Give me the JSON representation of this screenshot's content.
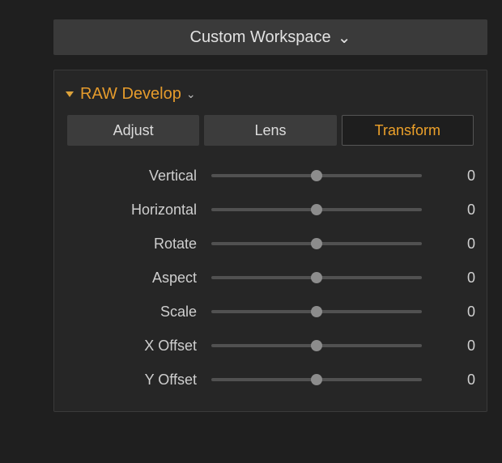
{
  "workspace": {
    "label": "Custom Workspace"
  },
  "section": {
    "title": "RAW Develop"
  },
  "tabs": [
    {
      "label": "Adjust",
      "active": false
    },
    {
      "label": "Lens",
      "active": false
    },
    {
      "label": "Transform",
      "active": true
    }
  ],
  "sliders": [
    {
      "label": "Vertical",
      "value": 0
    },
    {
      "label": "Horizontal",
      "value": 0
    },
    {
      "label": "Rotate",
      "value": 0
    },
    {
      "label": "Aspect",
      "value": 0
    },
    {
      "label": "Scale",
      "value": 0
    },
    {
      "label": "X Offset",
      "value": 0
    },
    {
      "label": "Y Offset",
      "value": 0
    }
  ]
}
